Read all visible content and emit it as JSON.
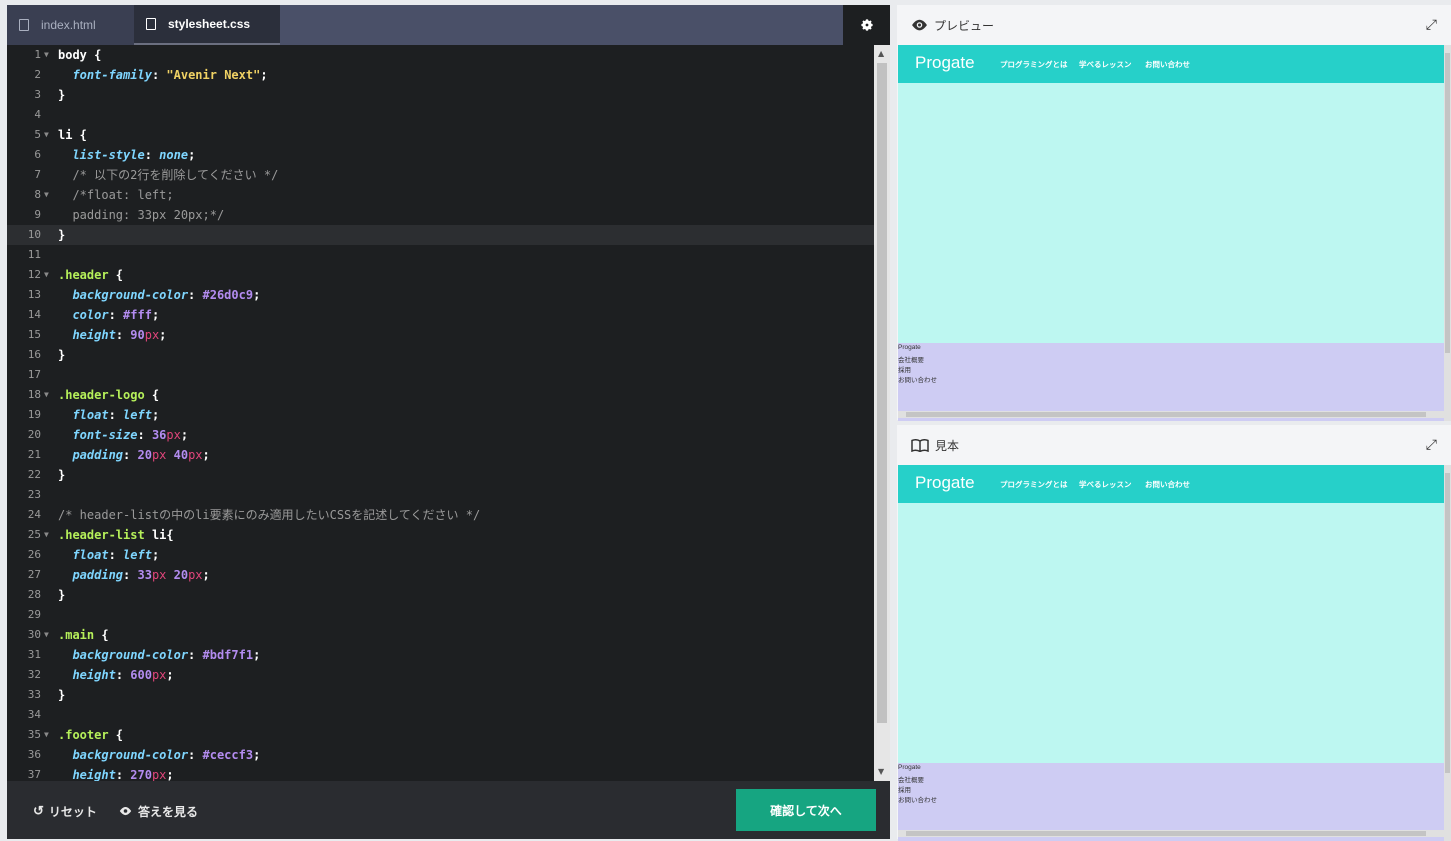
{
  "tabs": [
    {
      "label": "index.html",
      "active": false
    },
    {
      "label": "stylesheet.css",
      "active": true
    }
  ],
  "settings_icon": "gear-icon",
  "code_lines": [
    {
      "n": "1",
      "fold": true,
      "tokens": [
        [
          "sel",
          "body"
        ],
        [
          "pun",
          " {"
        ]
      ]
    },
    {
      "n": "2",
      "tokens": [
        [
          "pun",
          "  "
        ],
        [
          "prop",
          "font-family"
        ],
        [
          "pun",
          ": "
        ],
        [
          "str",
          "\"Avenir Next\""
        ],
        [
          "pun",
          ";"
        ]
      ]
    },
    {
      "n": "3",
      "tokens": [
        [
          "pun",
          "}"
        ]
      ]
    },
    {
      "n": "4",
      "tokens": []
    },
    {
      "n": "5",
      "fold": true,
      "tokens": [
        [
          "sel",
          "li"
        ],
        [
          "pun",
          " {"
        ]
      ]
    },
    {
      "n": "6",
      "tokens": [
        [
          "pun",
          "  "
        ],
        [
          "prop",
          "list-style"
        ],
        [
          "pun",
          ": "
        ],
        [
          "kw",
          "none"
        ],
        [
          "pun",
          ";"
        ]
      ]
    },
    {
      "n": "7",
      "tokens": [
        [
          "com",
          "  /* 以下の2行を削除してください */"
        ]
      ]
    },
    {
      "n": "8",
      "fold": true,
      "tokens": [
        [
          "com",
          "  /*float: left;"
        ]
      ]
    },
    {
      "n": "9",
      "tokens": [
        [
          "com",
          "  padding: 33px 20px;*/"
        ]
      ]
    },
    {
      "n": "10",
      "current": true,
      "tokens": [
        [
          "pun",
          "}"
        ]
      ]
    },
    {
      "n": "11",
      "tokens": []
    },
    {
      "n": "12",
      "fold": true,
      "tokens": [
        [
          "cls",
          ".header"
        ],
        [
          "pun",
          " {"
        ]
      ]
    },
    {
      "n": "13",
      "tokens": [
        [
          "pun",
          "  "
        ],
        [
          "prop",
          "background-color"
        ],
        [
          "pun",
          ": "
        ],
        [
          "num",
          "#26d0c9"
        ],
        [
          "pun",
          ";"
        ]
      ]
    },
    {
      "n": "14",
      "tokens": [
        [
          "pun",
          "  "
        ],
        [
          "prop",
          "color"
        ],
        [
          "pun",
          ": "
        ],
        [
          "num",
          "#fff"
        ],
        [
          "pun",
          ";"
        ]
      ]
    },
    {
      "n": "15",
      "tokens": [
        [
          "pun",
          "  "
        ],
        [
          "prop",
          "height"
        ],
        [
          "pun",
          ": "
        ],
        [
          "num",
          "90"
        ],
        [
          "unit",
          "px"
        ],
        [
          "pun",
          ";"
        ]
      ]
    },
    {
      "n": "16",
      "tokens": [
        [
          "pun",
          "}"
        ]
      ]
    },
    {
      "n": "17",
      "tokens": []
    },
    {
      "n": "18",
      "fold": true,
      "tokens": [
        [
          "cls",
          ".header-logo"
        ],
        [
          "pun",
          " {"
        ]
      ]
    },
    {
      "n": "19",
      "tokens": [
        [
          "pun",
          "  "
        ],
        [
          "prop",
          "float"
        ],
        [
          "pun",
          ": "
        ],
        [
          "kw",
          "left"
        ],
        [
          "pun",
          ";"
        ]
      ]
    },
    {
      "n": "20",
      "tokens": [
        [
          "pun",
          "  "
        ],
        [
          "prop",
          "font-size"
        ],
        [
          "pun",
          ": "
        ],
        [
          "num",
          "36"
        ],
        [
          "unit",
          "px"
        ],
        [
          "pun",
          ";"
        ]
      ]
    },
    {
      "n": "21",
      "tokens": [
        [
          "pun",
          "  "
        ],
        [
          "prop",
          "padding"
        ],
        [
          "pun",
          ": "
        ],
        [
          "num",
          "20"
        ],
        [
          "unit",
          "px"
        ],
        [
          "pun",
          " "
        ],
        [
          "num",
          "40"
        ],
        [
          "unit",
          "px"
        ],
        [
          "pun",
          ";"
        ]
      ]
    },
    {
      "n": "22",
      "tokens": [
        [
          "pun",
          "}"
        ]
      ]
    },
    {
      "n": "23",
      "tokens": []
    },
    {
      "n": "24",
      "tokens": [
        [
          "com",
          "/* header-listの中のli要素にのみ適用したいCSSを記述してください */"
        ]
      ]
    },
    {
      "n": "25",
      "fold": true,
      "tokens": [
        [
          "cls",
          ".header-list"
        ],
        [
          "pun",
          " "
        ],
        [
          "sel",
          "li"
        ],
        [
          "pun",
          "{"
        ]
      ]
    },
    {
      "n": "26",
      "tokens": [
        [
          "pun",
          "  "
        ],
        [
          "prop",
          "float"
        ],
        [
          "pun",
          ": "
        ],
        [
          "kw",
          "left"
        ],
        [
          "pun",
          ";"
        ]
      ]
    },
    {
      "n": "27",
      "tokens": [
        [
          "pun",
          "  "
        ],
        [
          "prop",
          "padding"
        ],
        [
          "pun",
          ": "
        ],
        [
          "num",
          "33"
        ],
        [
          "unit",
          "px"
        ],
        [
          "pun",
          " "
        ],
        [
          "num",
          "20"
        ],
        [
          "unit",
          "px"
        ],
        [
          "pun",
          ";"
        ]
      ]
    },
    {
      "n": "28",
      "tokens": [
        [
          "pun",
          "}"
        ]
      ]
    },
    {
      "n": "29",
      "tokens": []
    },
    {
      "n": "30",
      "fold": true,
      "tokens": [
        [
          "cls",
          ".main"
        ],
        [
          "pun",
          " {"
        ]
      ]
    },
    {
      "n": "31",
      "tokens": [
        [
          "pun",
          "  "
        ],
        [
          "prop",
          "background-color"
        ],
        [
          "pun",
          ": "
        ],
        [
          "num",
          "#bdf7f1"
        ],
        [
          "pun",
          ";"
        ]
      ]
    },
    {
      "n": "32",
      "tokens": [
        [
          "pun",
          "  "
        ],
        [
          "prop",
          "height"
        ],
        [
          "pun",
          ": "
        ],
        [
          "num",
          "600"
        ],
        [
          "unit",
          "px"
        ],
        [
          "pun",
          ";"
        ]
      ]
    },
    {
      "n": "33",
      "tokens": [
        [
          "pun",
          "}"
        ]
      ]
    },
    {
      "n": "34",
      "tokens": []
    },
    {
      "n": "35",
      "fold": true,
      "tokens": [
        [
          "cls",
          ".footer"
        ],
        [
          "pun",
          " {"
        ]
      ]
    },
    {
      "n": "36",
      "tokens": [
        [
          "pun",
          "  "
        ],
        [
          "prop",
          "background-color"
        ],
        [
          "pun",
          ": "
        ],
        [
          "num",
          "#ceccf3"
        ],
        [
          "pun",
          ";"
        ]
      ]
    },
    {
      "n": "37",
      "tokens": [
        [
          "pun",
          "  "
        ],
        [
          "prop",
          "height"
        ],
        [
          "pun",
          ": "
        ],
        [
          "num",
          "270"
        ],
        [
          "unit",
          "px"
        ],
        [
          "pun",
          ";"
        ]
      ]
    }
  ],
  "bottom": {
    "reset_label": "リセット",
    "answer_label": "答えを見る",
    "next_label": "確認して次へ"
  },
  "preview": {
    "title": "プレビュー",
    "icon": "eye-icon"
  },
  "sample": {
    "title": "見本",
    "icon": "book-icon"
  },
  "site": {
    "logo": "Progate",
    "nav": [
      "プログラミングとは",
      "学べるレッスン",
      "お問い合わせ"
    ],
    "footer": [
      "Progate",
      "会社概要",
      "採用",
      "お問い合わせ"
    ]
  },
  "colors": {
    "header": "#26d0c9",
    "main": "#bdf7f1",
    "footer": "#ceccf3",
    "next_button": "#16a581"
  }
}
